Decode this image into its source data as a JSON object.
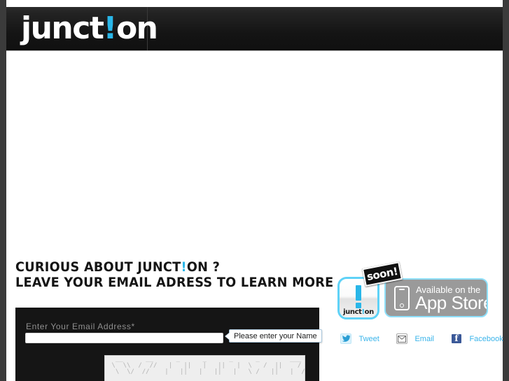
{
  "brand": {
    "name_before": "junct",
    "name_bang": "!",
    "name_after": "on"
  },
  "headline": {
    "line1_before": "CURIOUS ABOUT JUNCT",
    "line1_bang": "!",
    "line1_after": "ON ?",
    "line2": "LEAVE YOUR EMAIL ADRESS TO LEARN MORE"
  },
  "form": {
    "email_label": "Enter Your Email Address*",
    "email_value": "",
    "email_placeholder": "",
    "tooltip": "Please enter your Name",
    "captcha_art": "  __      __      _      _      _      _        ___\n \\  \\\\  /  //   |   ||   |   ||   |  \\   /  ||    / _  \\\\\n  \\  \\/  //    |   ||   |   ||   |   \\ /   ||   |  /  \\  ||"
  },
  "badges": {
    "app_icon_word_before": "junct",
    "app_icon_word_bang": "!",
    "app_icon_word_after": "on",
    "soon_label": "soon!",
    "appstore_top": "Available on the",
    "appstore_bottom": "App Store"
  },
  "social": {
    "tweet": "Tweet",
    "email": "Email",
    "facebook": "Facebook"
  },
  "colors": {
    "accent_cyan": "#29b6e8",
    "link_blue": "#3ab4ea",
    "panel_dark": "#151515",
    "facebook_blue": "#3b5998"
  }
}
